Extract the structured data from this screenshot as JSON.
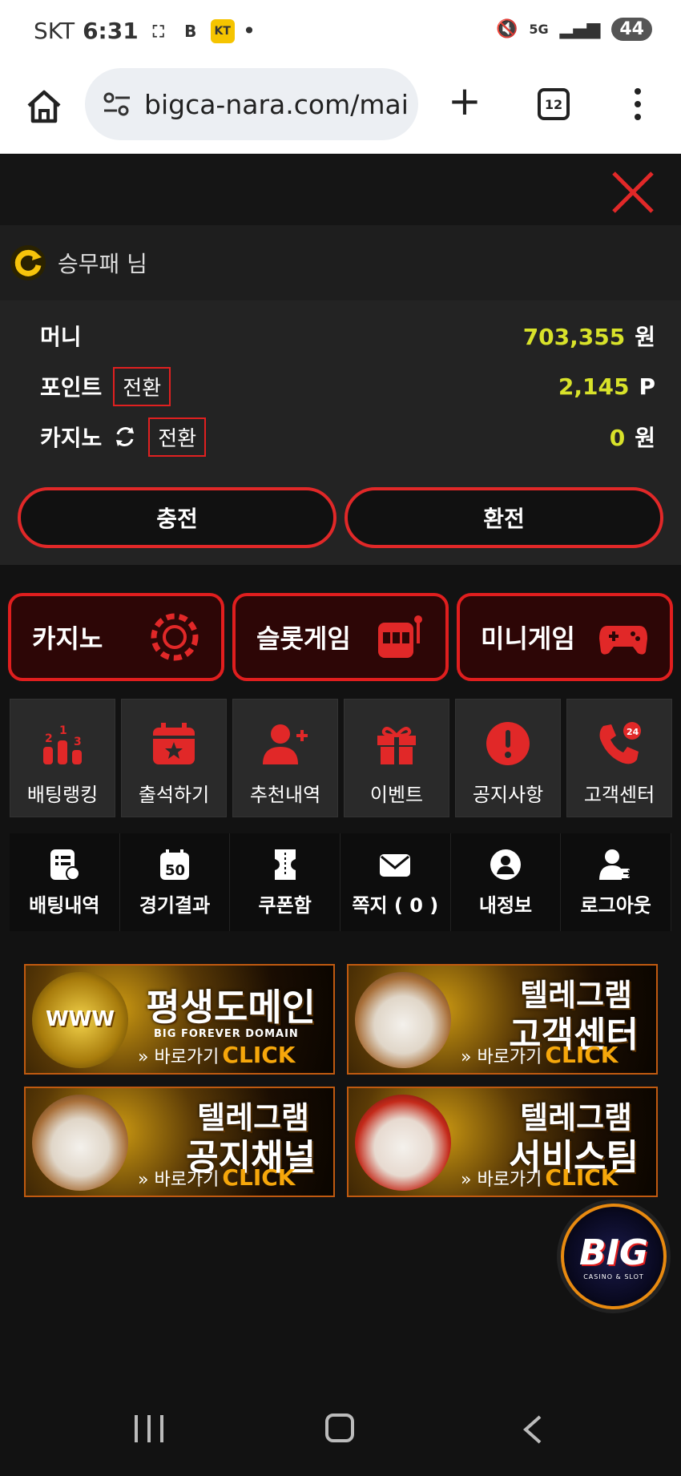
{
  "status": {
    "carrier": "SKT",
    "time": "6:31",
    "battery": "44",
    "network": "5G"
  },
  "browser": {
    "url": "bigca-nara.com/mai",
    "tab_count": "12"
  },
  "user": {
    "name": "승무패 님"
  },
  "wallet": {
    "money_label": "머니",
    "money_value": "703,355",
    "money_unit": "원",
    "point_label": "포인트",
    "point_convert": "전환",
    "point_value": "2,145",
    "point_unit": "P",
    "casino_label": "카지노",
    "casino_convert": "전환",
    "casino_value": "0",
    "casino_unit": "원",
    "deposit_label": "충전",
    "withdraw_label": "환전"
  },
  "categories": [
    {
      "label": "카지노",
      "icon": "chip-icon"
    },
    {
      "label": "슬롯게임",
      "icon": "slot-machine-icon"
    },
    {
      "label": "미니게임",
      "icon": "gamepad-icon"
    }
  ],
  "tiles": [
    {
      "label": "배팅랭킹",
      "icon": "ranking-icon"
    },
    {
      "label": "출석하기",
      "icon": "calendar-icon"
    },
    {
      "label": "추천내역",
      "icon": "add-user-icon"
    },
    {
      "label": "이벤트",
      "icon": "gift-icon"
    },
    {
      "label": "공지사항",
      "icon": "alert-icon"
    },
    {
      "label": "고객센터",
      "icon": "phone-24-icon"
    }
  ],
  "menu": [
    {
      "label": "배팅내역",
      "icon": "bet-list-icon"
    },
    {
      "label": "경기결과",
      "icon": "result-calendar-icon"
    },
    {
      "label": "쿠폰함",
      "icon": "coupon-icon"
    },
    {
      "label": "쪽지 ( 0 )",
      "icon": "mail-icon"
    },
    {
      "label": "내정보",
      "icon": "profile-icon"
    },
    {
      "label": "로그아웃",
      "icon": "logout-icon"
    }
  ],
  "banners": [
    {
      "title1": "",
      "title2": "평생도메인",
      "sub": "BIG FOREVER DOMAIN",
      "art": "WWW",
      "cta": "바로가기",
      "cta_click": "CLICK"
    },
    {
      "title1": "텔레그램",
      "title2": "고객센터",
      "sub": "",
      "art": "",
      "cta": "바로가기",
      "cta_click": "CLICK"
    },
    {
      "title1": "텔레그램",
      "title2": "공지채널",
      "sub": "",
      "art": "",
      "cta": "바로가기",
      "cta_click": "CLICK"
    },
    {
      "title1": "텔레그램",
      "title2": "서비스팀",
      "sub": "",
      "art": "",
      "cta": "바로가기",
      "cta_click": "CLICK"
    }
  ],
  "logo": {
    "text": "BIG",
    "sub": "CASINO & SLOT"
  },
  "colors": {
    "accent_red": "#e12828",
    "value_yellow": "#d8e22a",
    "background": "#121212"
  }
}
